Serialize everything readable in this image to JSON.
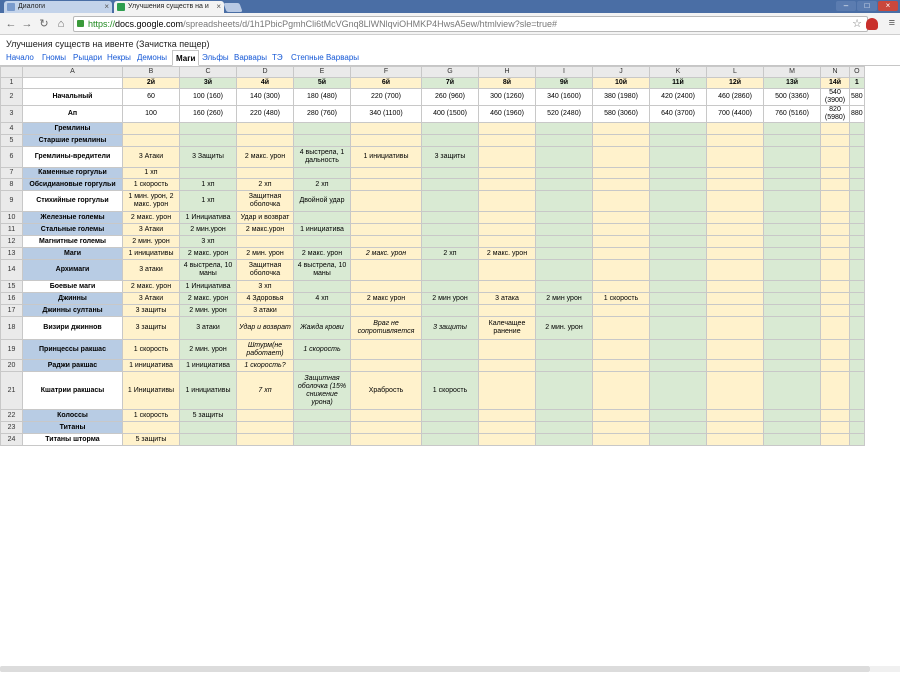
{
  "browser": {
    "tabs": [
      {
        "title": "Диалоги"
      },
      {
        "title": "Улучшения существ на и"
      }
    ],
    "url": {
      "scheme": "https://",
      "host": "docs.google.com",
      "path": "/spreadsheets/d/1h1PbicPgmhCli6tMcVGnq8LlWNlqviOHMKP4HwsA5ew/htmlview?sle=true#"
    },
    "colors": {
      "frame": "#4a6ea5",
      "secure": "#1f8a1f",
      "link": "#1558d6"
    }
  },
  "document": {
    "title": "Улучшения существ на ивенте (Зачистка пещер)"
  },
  "sheet_tabs": [
    {
      "label": "Начало",
      "active": false
    },
    {
      "label": "Гномы",
      "active": false
    },
    {
      "label": "Рыцари",
      "active": false
    },
    {
      "label": "Некры",
      "active": false
    },
    {
      "label": "Демоны",
      "active": false
    },
    {
      "label": "Маги",
      "active": true
    },
    {
      "label": "Эльфы",
      "active": false
    },
    {
      "label": "Варвары",
      "active": false
    },
    {
      "label": "ТЭ",
      "active": false
    },
    {
      "label": "Степные Варвары",
      "active": false
    }
  ],
  "grid": {
    "column_letters": [
      "A",
      "B",
      "C",
      "D",
      "E",
      "F",
      "G",
      "H",
      "I",
      "J",
      "K",
      "L",
      "M",
      "N",
      "O"
    ],
    "rows": [
      {
        "num": "1",
        "name": "",
        "cells": [
          "2й",
          "3й",
          "4й",
          "5й",
          "6й",
          "7й",
          "8й",
          "9й",
          "10й",
          "11й",
          "12й",
          "13й",
          "14й",
          "1"
        ]
      },
      {
        "num": "2",
        "name": "Начальный",
        "cells": [
          "60",
          "100 (160)",
          "140 (300)",
          "180 (480)",
          "220 (700)",
          "260 (960)",
          "300 (1260)",
          "340 (1600)",
          "380 (1980)",
          "420 (2400)",
          "460 (2860)",
          "500 (3360)",
          "540 (3900)",
          "580"
        ]
      },
      {
        "num": "3",
        "name": "Ап",
        "cells": [
          "100",
          "160 (260)",
          "220 (480)",
          "280 (760)",
          "340 (1100)",
          "400 (1500)",
          "460 (1960)",
          "520 (2480)",
          "580 (3060)",
          "640 (3700)",
          "700 (4400)",
          "760 (5160)",
          "820 (5980)",
          "880"
        ]
      },
      {
        "num": "4",
        "name": "Гремлины",
        "cells": [
          "",
          "",
          "",
          "",
          "",
          "",
          "",
          "",
          "",
          "",
          "",
          "",
          "",
          ""
        ]
      },
      {
        "num": "5",
        "name": "Старшие гремлины",
        "cells": [
          "",
          "",
          "",
          "",
          "",
          "",
          "",
          "",
          "",
          "",
          "",
          "",
          "",
          ""
        ]
      },
      {
        "num": "6",
        "name": "Гремлины-вредители",
        "cells": [
          "3 Атаки",
          "3 Защиты",
          "2 макс. урон",
          "4 выстрела, 1 дальность",
          "1 инициативы",
          "3 защиты",
          "",
          "",
          "",
          "",
          "",
          "",
          "",
          ""
        ]
      },
      {
        "num": "7",
        "name": "Каменные горгульи",
        "cells": [
          "1 хп",
          "",
          "",
          "",
          "",
          "",
          "",
          "",
          "",
          "",
          "",
          "",
          "",
          ""
        ]
      },
      {
        "num": "8",
        "name": "Обсидиановые горгульи",
        "cells": [
          "1 скорость",
          "1 хп",
          "2 хп",
          "2 хп",
          "",
          "",
          "",
          "",
          "",
          "",
          "",
          "",
          "",
          ""
        ]
      },
      {
        "num": "9",
        "name": "Стихийные горгульи",
        "cells": [
          "1 мин. урон, 2 макс. урон",
          "1 хп",
          "Защитная оболочка",
          "Двойной удар",
          "",
          "",
          "",
          "",
          "",
          "",
          "",
          "",
          "",
          ""
        ]
      },
      {
        "num": "10",
        "name": "Железные големы",
        "cells": [
          "2 макс. урон",
          "1 Инициатива",
          "Удар и возврат",
          "",
          "",
          "",
          "",
          "",
          "",
          "",
          "",
          "",
          "",
          ""
        ]
      },
      {
        "num": "11",
        "name": "Стальные големы",
        "cells": [
          "3 Атаки",
          "2 мин.урон",
          "2 макс.урон",
          "1 инициатива",
          "",
          "",
          "",
          "",
          "",
          "",
          "",
          "",
          "",
          ""
        ]
      },
      {
        "num": "12",
        "name": "Магнитные големы",
        "cells": [
          "2 мин. урон",
          "3 хп",
          "",
          "",
          "",
          "",
          "",
          "",
          "",
          "",
          "",
          "",
          "",
          ""
        ]
      },
      {
        "num": "13",
        "name": "Маги",
        "cells": [
          "1 инициативы",
          "2 макс. урон",
          "2 мин. урон",
          "2 макс. урон",
          "2 макс. урон",
          "2 хп",
          "2 макс. урон",
          "",
          "",
          "",
          "",
          "",
          "",
          ""
        ]
      },
      {
        "num": "14",
        "name": "Архимаги",
        "cells": [
          "3 атаки",
          "4 выстрела, 10 маны",
          "Защитная оболочка",
          "4 выстрела, 10 маны",
          "",
          "",
          "",
          "",
          "",
          "",
          "",
          "",
          "",
          ""
        ]
      },
      {
        "num": "15",
        "name": "Боевые маги",
        "cells": [
          "2 макс. урон",
          "1 Инициатива",
          "3 хп",
          "",
          "",
          "",
          "",
          "",
          "",
          "",
          "",
          "",
          "",
          ""
        ]
      },
      {
        "num": "16",
        "name": "Джинны",
        "cells": [
          "3 Атаки",
          "2 макс. урон",
          "4 Здоровья",
          "4 хп",
          "2 макс урон",
          "2 мин урон",
          "3 атака",
          "2 мин урон",
          "1 скорость",
          "",
          "",
          "",
          "",
          ""
        ]
      },
      {
        "num": "17",
        "name": "Джинны султаны",
        "cells": [
          "3 защиты",
          "2 мин. урон",
          "3 атаки",
          "",
          "",
          "",
          "",
          "",
          "",
          "",
          "",
          "",
          "",
          ""
        ]
      },
      {
        "num": "18",
        "name": "Визири джиннов",
        "cells": [
          "3 защиты",
          "3 атаки",
          "Удар и возврат",
          "Жажда крови",
          "Враг не сопротивляется",
          "3 защиты",
          "Калечащее ранение",
          "2 мин. урон",
          "",
          "",
          "",
          "",
          "",
          ""
        ]
      },
      {
        "num": "19",
        "name": "Принцессы ракшас",
        "cells": [
          "1 скорость",
          "2 мин. урон",
          "Штурм(не работает)",
          "1 скорость",
          "",
          "",
          "",
          "",
          "",
          "",
          "",
          "",
          "",
          ""
        ]
      },
      {
        "num": "20",
        "name": "Раджи ракшас",
        "cells": [
          "1 инициатива",
          "1 инициатива",
          "1 скорость?",
          "",
          "",
          "",
          "",
          "",
          "",
          "",
          "",
          "",
          "",
          ""
        ]
      },
      {
        "num": "21",
        "name": "Кшатрии ракшасы",
        "cells": [
          "1 Инициативы",
          "1 инициативы",
          "7 хп",
          "Защитная оболочка (15% снижение урона)",
          "Храбрость",
          "1 скорость",
          "",
          "",
          "",
          "",
          "",
          "",
          "",
          ""
        ]
      },
      {
        "num": "22",
        "name": "Колоссы",
        "cells": [
          "1 скорость",
          "5 защиты",
          "",
          "",
          "",
          "",
          "",
          "",
          "",
          "",
          "",
          "",
          "",
          ""
        ]
      },
      {
        "num": "23",
        "name": "Титаны",
        "cells": [
          "",
          "",
          "",
          "",
          "",
          "",
          "",
          "",
          "",
          "",
          "",
          "",
          "",
          ""
        ]
      },
      {
        "num": "24",
        "name": "Титаны шторма",
        "cells": [
          "5 защиты",
          "",
          "",
          "",
          "",
          "",
          "",
          "",
          "",
          "",
          "",
          "",
          "",
          ""
        ]
      }
    ]
  }
}
